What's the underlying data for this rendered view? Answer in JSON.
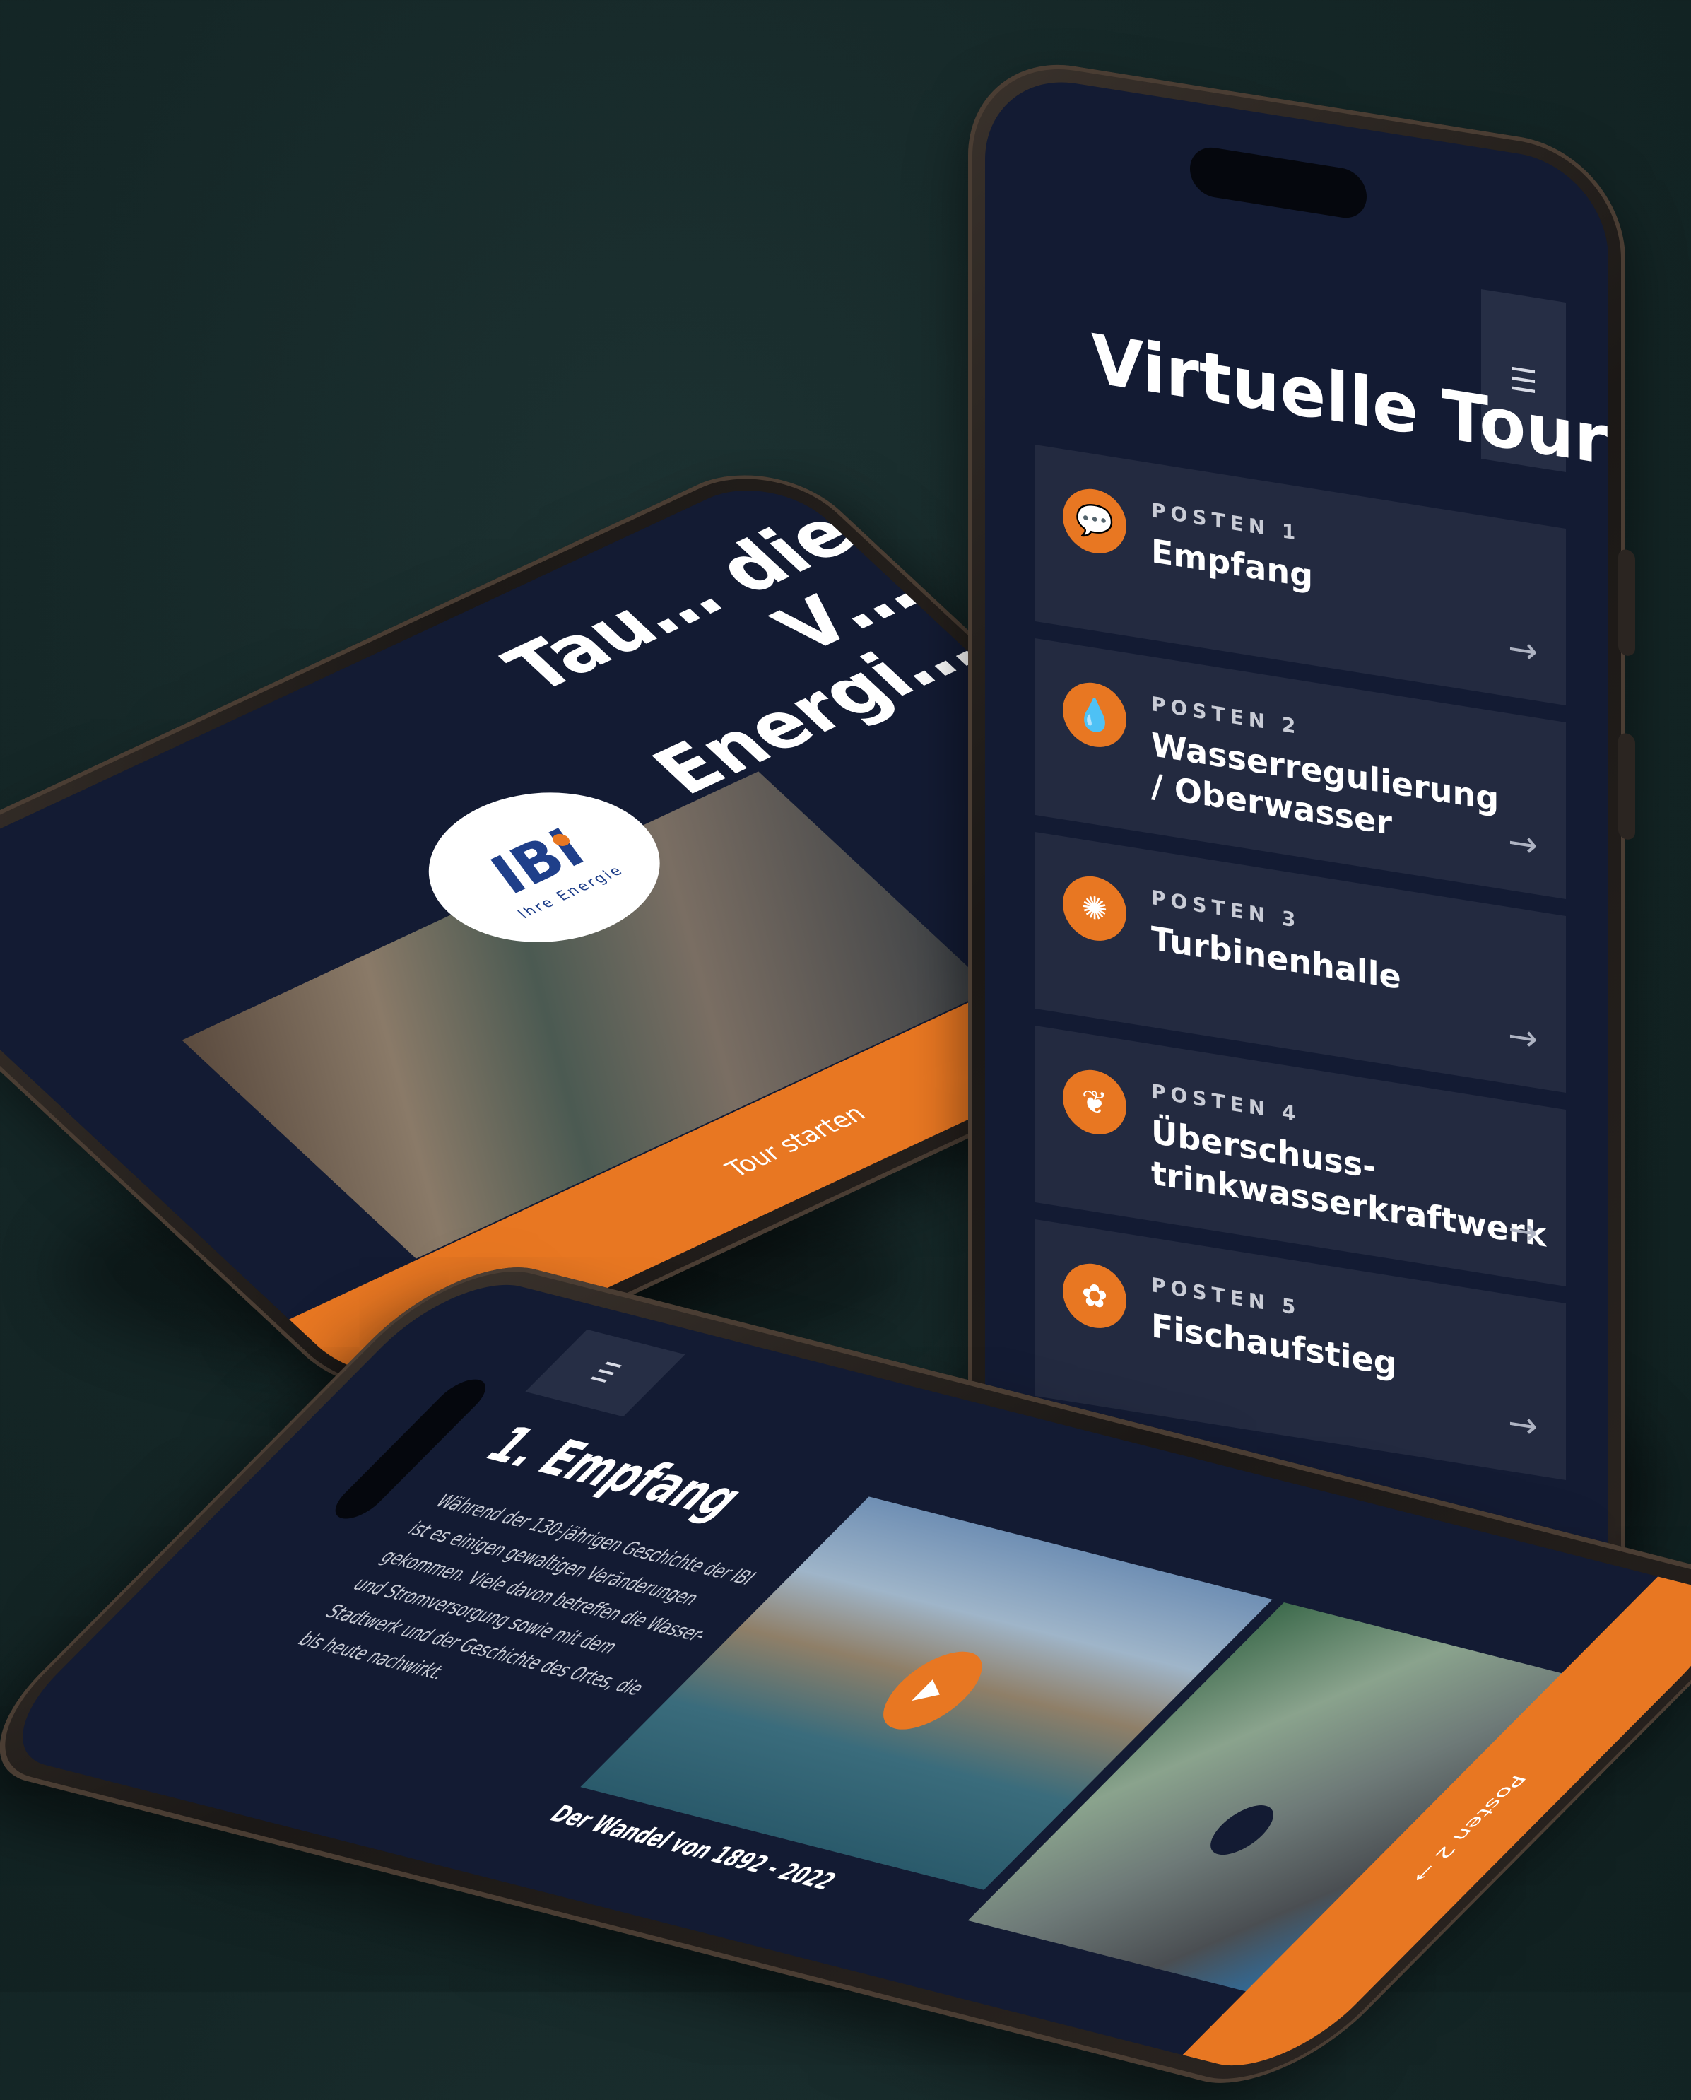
{
  "colors": {
    "background": "#152727",
    "screen": "#131b33",
    "card": "#232a40",
    "accent": "#e87722",
    "text": "#ffffff",
    "muted": "#c9ccd6"
  },
  "tour": {
    "title": "Virtuelle Tour",
    "menu_icon": "hamburger-menu-icon",
    "posts": [
      {
        "label": "POSTEN 1",
        "name": "Empfang",
        "icon": "speech-bubble-icon",
        "glyph": "💬"
      },
      {
        "label": "POSTEN 2",
        "name": "Wasserregulierung / Oberwasser",
        "icon": "water-drop-icon",
        "glyph": "💧"
      },
      {
        "label": "POSTEN 3",
        "name": "Turbinenhalle",
        "icon": "turbine-icon",
        "glyph": "✺"
      },
      {
        "label": "POSTEN 4",
        "name": "Überschuss-trinkwasserkraftwerk",
        "icon": "power-leaf-icon",
        "glyph": "❦"
      },
      {
        "label": "POSTEN 5",
        "name": "Fischaufstieg",
        "icon": "fish-icon",
        "glyph": "✿"
      }
    ],
    "arrow_glyph": "→"
  },
  "landing": {
    "title": "Tau… die V… Energi…",
    "logo_text": "IBI",
    "logo_subtext": "Ihre Energie",
    "start_label": "Tour starten"
  },
  "detail": {
    "menu_icon": "hamburger-menu-icon",
    "title": "1. Empfang",
    "text": "Während der 130-jährigen Geschichte der IBI ist es einigen gewaltigen Veränderungen gekommen. Viele davon betreffen die Wasser- und Stromversorgung sowie mit dem Stadtwerk und der Geschichte des Ortes, die bis heute nachwirkt.",
    "play_glyph": "▶",
    "caption": "Der Wandel von 1892 - 2022",
    "next_label": "Posten 2 →"
  }
}
